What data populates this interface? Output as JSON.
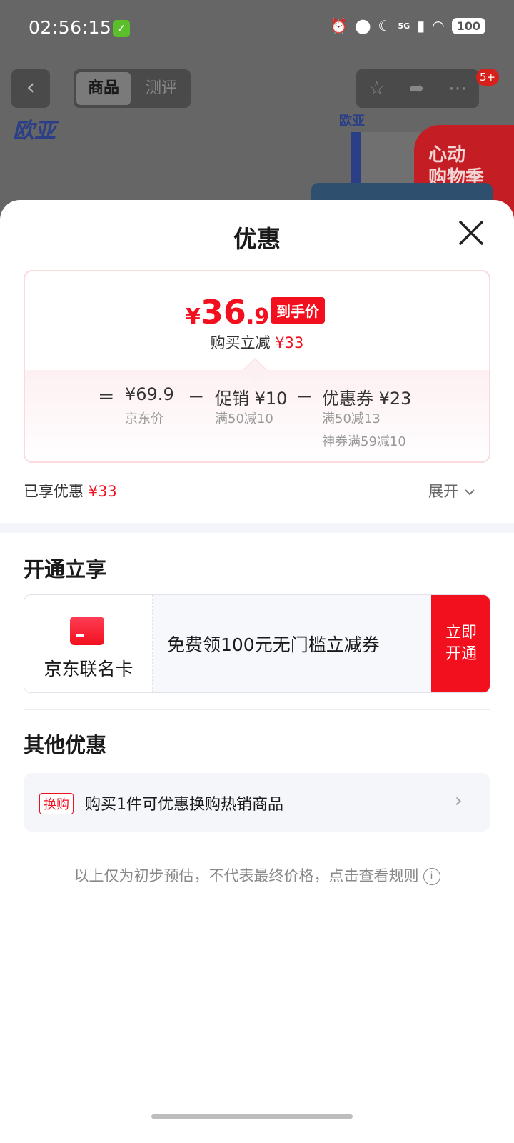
{
  "status_bar": {
    "time": "02:56:15",
    "network": "5G",
    "battery": "100"
  },
  "product_page": {
    "tabs": [
      "商品",
      "测评"
    ],
    "active_tab": "商品",
    "notification_badge": "5+",
    "brand_logo": "欧亚",
    "promo_banner": "心动 购物季"
  },
  "sheet": {
    "title": "优惠",
    "price_card": {
      "currency": "¥",
      "final_int": "36",
      "final_dec": ".9",
      "final_tag": "到手价",
      "buy_reduce_label": "购买立减",
      "buy_reduce_value": "¥33",
      "equals": "=",
      "minus": "−",
      "jd_price": "¥69.9",
      "jd_price_label": "京东价",
      "promo": "促销 ¥10",
      "promo_rule": "满50减10",
      "coupon": "优惠券 ¥23",
      "coupon_rule_1": "满50减13",
      "coupon_rule_2": "神券满59减10"
    },
    "enjoyed_label": "已享优惠",
    "enjoyed_value": "¥33",
    "expand_label": "展开",
    "open_section": {
      "title": "开通立享",
      "card_name": "京东联名卡",
      "card_desc": "免费领100元无门槛立减券",
      "cta": "立即开通"
    },
    "other_section": {
      "title": "其他优惠",
      "tag": "换购",
      "text": "购买1件可优惠换购热销商品"
    },
    "footnote": "以上仅为初步预估，不代表最终价格，点击查看规则"
  },
  "colors": {
    "accent_red": "#f2101f",
    "card_border": "#fbd9dc",
    "brand_blue": "#2b3f86"
  }
}
